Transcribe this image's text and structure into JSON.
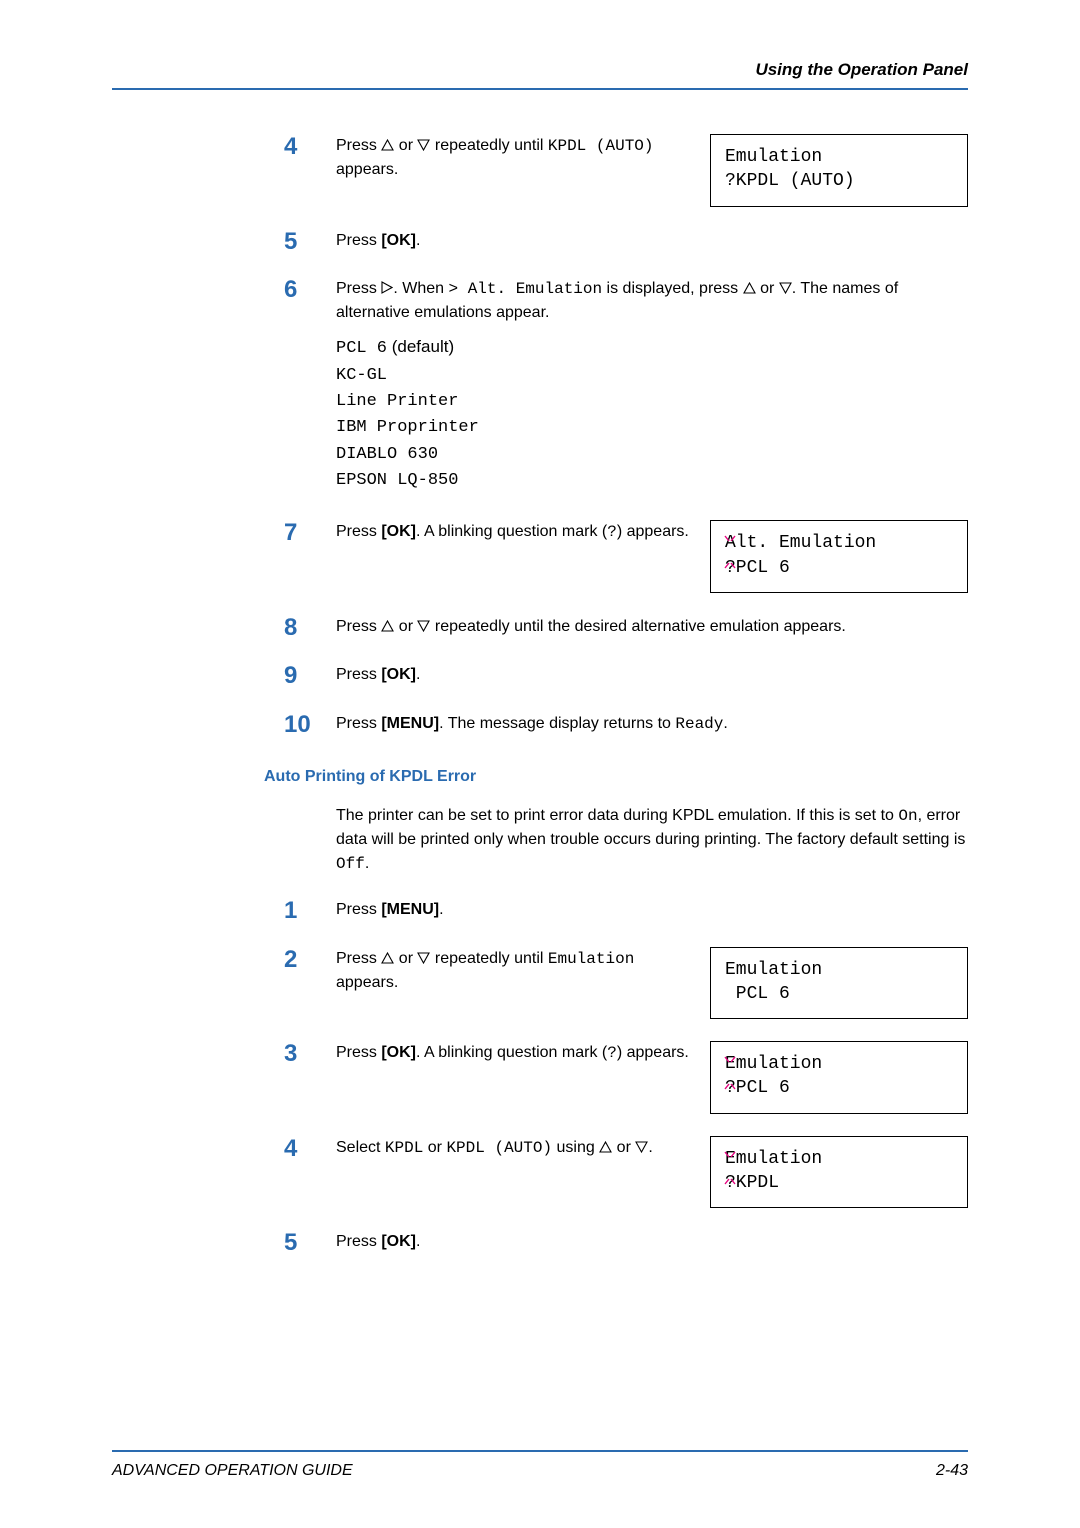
{
  "header": {
    "title": "Using the Operation Panel"
  },
  "steps_a": {
    "s4": {
      "num": "4",
      "pre": "Press ",
      "mid": " or ",
      "post": " repeatedly until ",
      "code1": "KPDL (AUTO)",
      "tail": " appears."
    },
    "s5": {
      "num": "5",
      "pre": "Press ",
      "ok": "[OK]",
      "tail": "."
    },
    "s6": {
      "num": "6",
      "pre": "Press ",
      "when": ". When ",
      "code_gt": "> Alt. Emulation",
      "disp": " is displayed, press ",
      "or": " or ",
      "tail": ". The names of alternative emulations appear."
    },
    "emulist": {
      "l1_code": "PCL 6",
      "l1_def": " (default)",
      "l2": "KC-GL",
      "l3": "Line Printer",
      "l4": "IBM Proprinter",
      "l5": "DIABLO 630",
      "l6": "EPSON LQ-850"
    },
    "s7": {
      "num": "7",
      "pre": "Press ",
      "ok": "[OK]",
      "post": ". A blinking question mark (",
      "q": "?",
      "tail": ") appears."
    },
    "s8": {
      "num": "8",
      "pre": "Press ",
      "or": " or ",
      "tail": " repeatedly until the desired alternative emulation appears."
    },
    "s9": {
      "num": "9",
      "pre": "Press ",
      "ok": "[OK]",
      "tail": "."
    },
    "s10": {
      "num": "10",
      "pre": "Press ",
      "menu": "[MENU]",
      "mid": ". The message display returns to ",
      "ready": "Ready",
      "tail": "."
    }
  },
  "section2": {
    "heading": "Auto Printing of KPDL Error",
    "para_pre": "The printer can be set to print error data during KPDL emulation. If this is set to ",
    "on": "On",
    "para_mid": ", error data will be printed only when trouble occurs during printing. The factory default setting is ",
    "off": "Off",
    "para_tail": "."
  },
  "steps_b": {
    "s1": {
      "num": "1",
      "pre": "Press ",
      "menu": "[MENU]",
      "tail": "."
    },
    "s2": {
      "num": "2",
      "pre": "Press ",
      "or": " or ",
      "post": " repeatedly until ",
      "emul": "Emulation",
      "tail": " appears."
    },
    "s3": {
      "num": "3",
      "pre": "Press ",
      "ok": "[OK]",
      "post": ". A blinking question mark (",
      "q": "?",
      "tail": ") appears."
    },
    "s4": {
      "num": "4",
      "pre": "Select ",
      "k1": "KPDL",
      "or": " or ",
      "k2": "KPDL (AUTO)",
      "using": " using ",
      "or2": " or ",
      "tail": "."
    },
    "s5": {
      "num": "5",
      "pre": "Press ",
      "ok": "[OK]",
      "tail": "."
    }
  },
  "displays": {
    "d1": {
      "l1": "Emulation",
      "l2": "?KPDL (AUTO)"
    },
    "d2": {
      "l1": "Alt. Emulation",
      "l2": "?PCL 6"
    },
    "d3": {
      "l1": "Emulation",
      "l2": " PCL 6"
    },
    "d4": {
      "l1": "Emulation",
      "l2": "?PCL 6"
    },
    "d5": {
      "l1": "Emulation",
      "l2": "?KPDL"
    }
  },
  "footer": {
    "left": "ADVANCED OPERATION GUIDE",
    "right": "2-43"
  }
}
